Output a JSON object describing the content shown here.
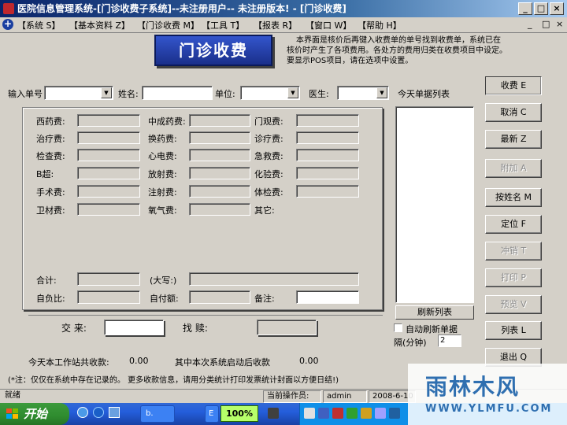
{
  "window": {
    "title": "医院信息管理系统-[门诊收费子系统]--未注册用户-- 未注册版本! - [门诊收费]",
    "min": "_",
    "max": "□",
    "close": "×"
  },
  "menu": {
    "items": [
      "【系统 S】",
      "【基本资料 Z】",
      "【门诊收费 M】",
      "【工具 T】",
      "【报表 R】",
      "【窗口 W】",
      "【帮助 H】"
    ],
    "right_controls": [
      "_",
      "□",
      "×"
    ]
  },
  "header": {
    "title": "门诊收费",
    "note_lines": [
      "本界面是核价后再键入收费单的单号找到收费单，系统已在",
      "核价时产生了各项费用。各处方的费用归类在收费项目中设定。",
      "要显示POS项目，请在选项中设置。"
    ]
  },
  "form": {
    "order_no_label": "输入单号",
    "name_label": "姓名:",
    "unit_label": "单位:",
    "doctor_label": "医生:",
    "today_list_label": "今天单据列表"
  },
  "fees": [
    [
      "西药费:",
      "中成药费:",
      "门观费:"
    ],
    [
      "治疗费:",
      "换药费:",
      "诊疗费:"
    ],
    [
      "检查费:",
      "心电费:",
      "急救费:"
    ],
    [
      "B超:",
      "放射费:",
      "化验费:"
    ],
    [
      "手术费:",
      "注射费:",
      "体检费:"
    ],
    [
      "卫材费:",
      "氧气费:",
      "其它:"
    ]
  ],
  "totals": {
    "total_label": "合计:",
    "caps_label": "(大写:)",
    "self_ratio_label": "自负比:",
    "self_pay_label": "自付额:",
    "remark_label": "备注:"
  },
  "payment": {
    "paid_label": "交  来:",
    "change_label": "找  赎:"
  },
  "summary": {
    "station_total_label": "今天本工作站共收款:",
    "station_total_value": "0.00",
    "since_start_label": "其中本次系统启动后收款",
    "since_start_value": "0.00",
    "footnote": "(*注：仅仅在系统中存在记录的。 更多收款信息，请用分类统计打印发票统计封面以方便日结!)"
  },
  "list": {
    "refresh_button": "刷新列表",
    "auto_refresh_label": "自动刷新单据",
    "interval_label": "隔(分钟)",
    "interval_value": "2"
  },
  "buttons": [
    {
      "label": "收费 E",
      "enabled": true
    },
    {
      "label": "取消 C",
      "enabled": true
    },
    {
      "label": "最新 Z",
      "enabled": true
    },
    {
      "label": "附加 A",
      "enabled": false
    },
    {
      "label": "按姓名 M",
      "enabled": true
    },
    {
      "label": "定位 F",
      "enabled": true
    },
    {
      "label": "冲销 T",
      "enabled": false
    },
    {
      "label": "打印 P",
      "enabled": false
    },
    {
      "label": "预览 V",
      "enabled": false
    },
    {
      "label": "列表 L",
      "enabled": true
    },
    {
      "label": "退出 Q",
      "enabled": true
    }
  ],
  "status": {
    "ready": "就绪",
    "operator_label": "当前操作员:",
    "operator": "admin",
    "date": "2008-6-10"
  },
  "taskbar": {
    "start": "开始",
    "task_label": "b.",
    "task2_label": "E",
    "zoom": "100%"
  },
  "watermark": {
    "title": "雨林木风",
    "url": "WWW.YLMFU.COM"
  },
  "colors": {
    "title_bar": "#0a246a",
    "header_box": "#1a2f8a",
    "form_bg": "#d4d0c8"
  }
}
